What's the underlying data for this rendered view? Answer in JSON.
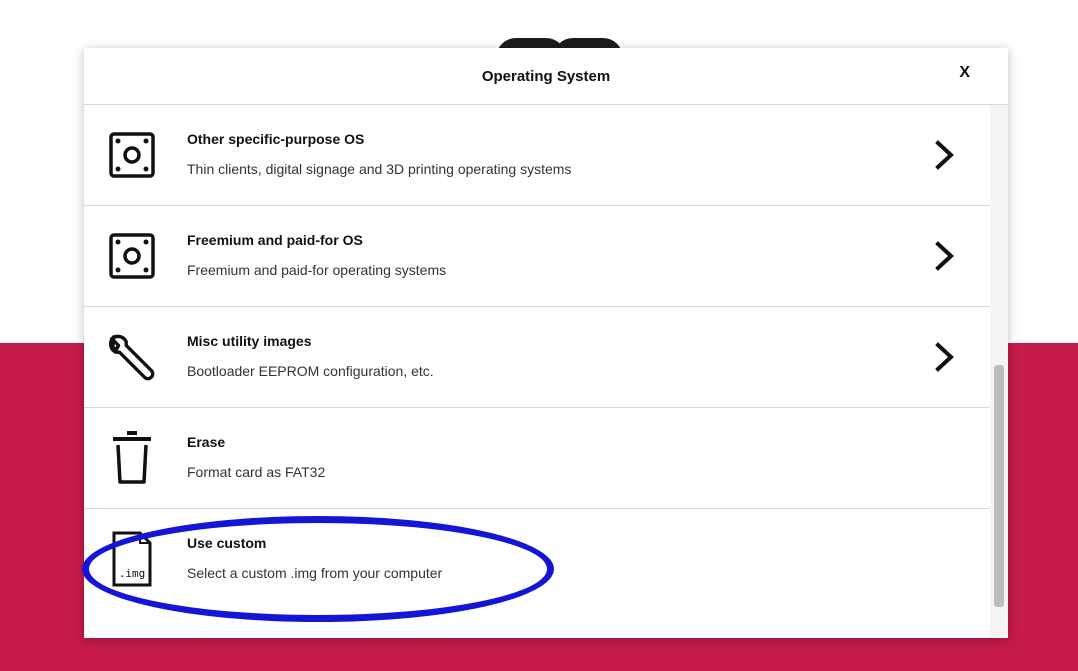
{
  "dialog": {
    "title": "Operating System",
    "close_label": "X"
  },
  "items": [
    {
      "title": "Other specific-purpose OS",
      "description": "Thin clients, digital signage and 3D printing operating systems",
      "icon": "chip-icon",
      "has_submenu": true
    },
    {
      "title": "Freemium and paid-for OS",
      "description": "Freemium and paid-for operating systems",
      "icon": "chip-icon",
      "has_submenu": true
    },
    {
      "title": "Misc utility images",
      "description": "Bootloader EEPROM configuration, etc.",
      "icon": "wrench-icon",
      "has_submenu": true
    },
    {
      "title": "Erase",
      "description": "Format card as FAT32",
      "icon": "trash-icon",
      "has_submenu": false
    },
    {
      "title": "Use custom",
      "description": "Select a custom .img from your computer",
      "icon": "img-file-icon",
      "icon_text": ".img",
      "has_submenu": false
    }
  ],
  "colors": {
    "accent": "#c51a4a",
    "annotation": "#1515d6"
  }
}
